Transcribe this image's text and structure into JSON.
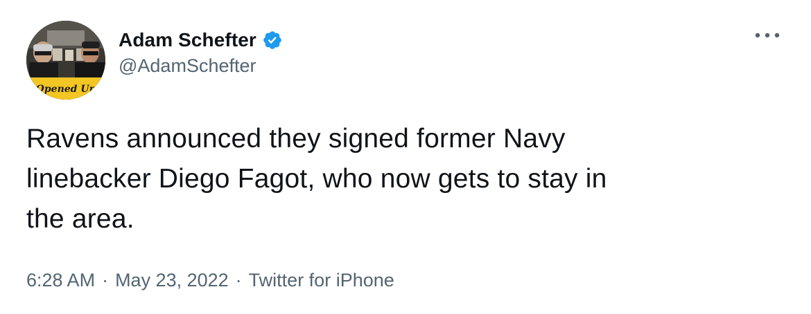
{
  "tweet": {
    "author": {
      "display_name": "Adam Schefter",
      "handle": "@AdamSchefter",
      "verified_icon": "verified-badge-icon",
      "avatar_text": "Opened Up"
    },
    "more_icon": "more-options-icon",
    "text_lines": [
      "Ravens announced they signed former Navy",
      "linebacker Diego Fagot, who now gets to stay in",
      "the area."
    ],
    "time": "6:28 AM",
    "separator": "·",
    "date": "May 23, 2022",
    "source": "Twitter for iPhone"
  },
  "colors": {
    "text_primary": "#0f1419",
    "text_secondary": "#536471",
    "verified_blue": "#1d9bf0",
    "avatar_yellow": "#f3c623"
  }
}
